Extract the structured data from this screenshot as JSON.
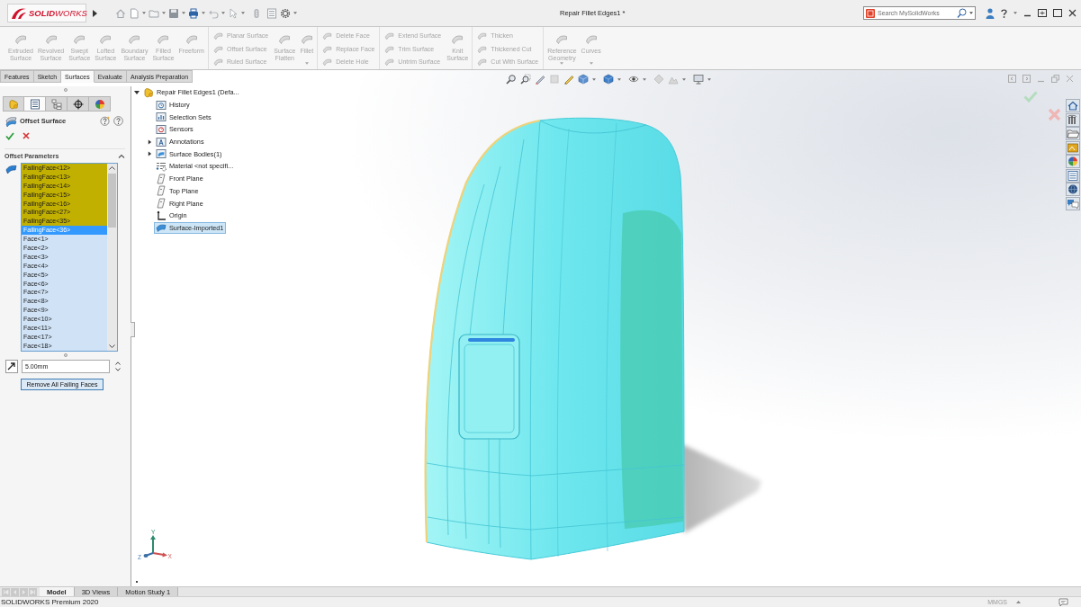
{
  "title_bar": {
    "logo": "**SOLID**WORKS",
    "title": "Repair Fillet Edges1 *",
    "search": {
      "placeholder": "Search MySolidWorks"
    }
  },
  "ribbon": {
    "sections": [
      {
        "items": [
          {
            "kind": "large",
            "label": "Extruded Surface",
            "disabled": true
          },
          {
            "kind": "large",
            "label": "Revolved Surface",
            "disabled": true
          },
          {
            "kind": "large",
            "label": "Swept Surface",
            "disabled": true
          },
          {
            "kind": "large",
            "label": "Lofted Surface",
            "disabled": true
          },
          {
            "kind": "large",
            "label": "Boundary Surface",
            "disabled": true
          },
          {
            "kind": "large",
            "label": "Filled Surface",
            "disabled": true
          },
          {
            "kind": "large",
            "label": "Freeform",
            "disabled": true
          }
        ]
      },
      {
        "items": [
          {
            "kind": "stack",
            "buttons": [
              {
                "label": "Planar Surface",
                "disabled": true
              },
              {
                "label": "Offset Surface",
                "disabled": true
              },
              {
                "label": "Ruled Surface",
                "disabled": true
              }
            ]
          },
          {
            "kind": "large",
            "label": "Surface Flatten",
            "disabled": true
          },
          {
            "kind": "large",
            "label": "Fillet",
            "disabled": true,
            "dropdown": true
          }
        ]
      },
      {
        "items": [
          {
            "kind": "stack",
            "buttons": [
              {
                "label": "Delete Face",
                "disabled": true
              },
              {
                "label": "Replace Face",
                "disabled": true
              },
              {
                "label": "Delete Hole",
                "disabled": true
              }
            ]
          }
        ]
      },
      {
        "items": [
          {
            "kind": "stack",
            "buttons": [
              {
                "label": "Extend Surface",
                "disabled": true
              },
              {
                "label": "Trim Surface",
                "disabled": true
              },
              {
                "label": "Untrim Surface",
                "disabled": true
              }
            ]
          },
          {
            "kind": "large",
            "label": "Knit Surface",
            "disabled": true
          }
        ]
      },
      {
        "items": [
          {
            "kind": "stack",
            "buttons": [
              {
                "label": "Thicken",
                "disabled": true
              },
              {
                "label": "Thickened Cut",
                "disabled": true
              },
              {
                "label": "Cut With Surface",
                "disabled": true
              }
            ]
          }
        ]
      },
      {
        "items": [
          {
            "kind": "large",
            "label": "Reference Geometry",
            "disabled": true,
            "dropdown": true
          },
          {
            "kind": "large",
            "label": "Curves",
            "disabled": true,
            "dropdown": true
          }
        ]
      }
    ]
  },
  "command_tabs": [
    {
      "label": "Features",
      "selected": false
    },
    {
      "label": "Sketch",
      "selected": false
    },
    {
      "label": "Surfaces",
      "selected": true
    },
    {
      "label": "Evaluate",
      "selected": false
    },
    {
      "label": "Analysis Preparation",
      "selected": false
    }
  ],
  "property_manager": {
    "tabs": [
      {
        "selected": false
      },
      {
        "selected": true
      },
      {
        "selected": false
      },
      {
        "selected": false
      },
      {
        "selected": false
      }
    ],
    "title": "Offset Surface",
    "section": {
      "title": "Offset Parameters",
      "expanded": true
    },
    "faces": [
      {
        "label": "FailingFace<12>",
        "kind": "failing",
        "selected": false
      },
      {
        "label": "FailingFace<13>",
        "kind": "failing",
        "selected": false
      },
      {
        "label": "FailingFace<14>",
        "kind": "failing",
        "selected": false
      },
      {
        "label": "FailingFace<15>",
        "kind": "failing",
        "selected": false
      },
      {
        "label": "FailingFace<16>",
        "kind": "failing",
        "selected": false
      },
      {
        "label": "FailingFace<27>",
        "kind": "failing",
        "selected": false
      },
      {
        "label": "FailingFace<35>",
        "kind": "failing",
        "selected": false
      },
      {
        "label": "FailingFace<36>",
        "kind": "failing",
        "selected": true
      },
      {
        "label": "Face<1>",
        "kind": "face",
        "selected": false
      },
      {
        "label": "Face<2>",
        "kind": "face",
        "selected": false
      },
      {
        "label": "Face<3>",
        "kind": "face",
        "selected": false
      },
      {
        "label": "Face<4>",
        "kind": "face",
        "selected": false
      },
      {
        "label": "Face<5>",
        "kind": "face",
        "selected": false
      },
      {
        "label": "Face<6>",
        "kind": "face",
        "selected": false
      },
      {
        "label": "Face<7>",
        "kind": "face",
        "selected": false
      },
      {
        "label": "Face<8>",
        "kind": "face",
        "selected": false
      },
      {
        "label": "Face<9>",
        "kind": "face",
        "selected": false
      },
      {
        "label": "Face<10>",
        "kind": "face",
        "selected": false
      },
      {
        "label": "Face<11>",
        "kind": "face",
        "selected": false
      },
      {
        "label": "Face<17>",
        "kind": "face",
        "selected": false
      },
      {
        "label": "Face<18>",
        "kind": "face",
        "selected": false
      }
    ],
    "distance": {
      "value": "5.00mm"
    },
    "button": "Remove All Failing Faces"
  },
  "feature_tree": {
    "label": "Repair Fillet Edges1 (Defa...",
    "kind": "part",
    "expanded": true,
    "selected": false,
    "children": [
      {
        "label": "History",
        "kind": "history",
        "selected": false
      },
      {
        "label": "Selection Sets",
        "kind": "selection_sets",
        "selected": false
      },
      {
        "label": "Sensors",
        "kind": "sensors",
        "selected": false
      },
      {
        "label": "Annotations",
        "kind": "annotations",
        "expanded": false,
        "selected": false
      },
      {
        "label": "Surface Bodies(1)",
        "kind": "bodies",
        "expanded": false,
        "selected": false
      },
      {
        "label": "Material <not specifi...",
        "kind": "material",
        "selected": false
      },
      {
        "label": "Front Plane",
        "kind": "plane",
        "selected": false
      },
      {
        "label": "Top Plane",
        "kind": "plane",
        "selected": false
      },
      {
        "label": "Right Plane",
        "kind": "plane",
        "selected": false
      },
      {
        "label": "Origin",
        "kind": "origin",
        "selected": false
      },
      {
        "label": "Surface-Imported1",
        "kind": "surface",
        "selected": true
      }
    ]
  },
  "triad": {
    "x": "X",
    "y": "Y",
    "z": "Z"
  },
  "bottom_tabs": [
    {
      "label": "Model",
      "selected": true
    },
    {
      "label": "3D Views",
      "selected": false
    },
    {
      "label": "Motion Study 1",
      "selected": false
    }
  ],
  "status_bar": {
    "product": "SOLIDWORKS Premium 2020",
    "units": "MMGS"
  }
}
